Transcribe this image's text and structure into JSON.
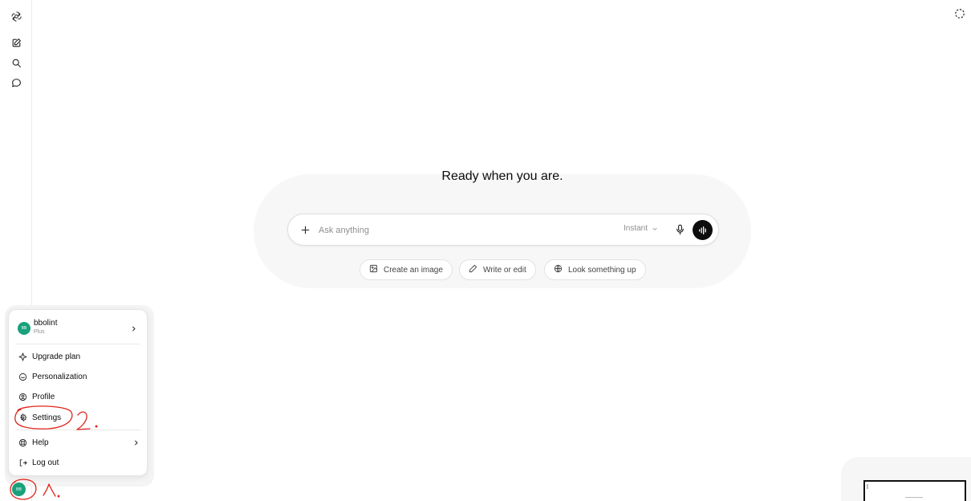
{
  "sidebar": {
    "logo_icon": "openai-logo-icon",
    "items": [
      {
        "name": "new-chat",
        "icon": "edit-icon"
      },
      {
        "name": "search",
        "icon": "search-icon"
      },
      {
        "name": "chats",
        "icon": "chat-bubble-icon"
      }
    ]
  },
  "main": {
    "headline": "Ready when you are.",
    "composer": {
      "placeholder": "Ask anything",
      "model": "Instant"
    },
    "chips": [
      {
        "label": "Create an image",
        "icon": "image-icon"
      },
      {
        "label": "Write or edit",
        "icon": "pen-icon"
      },
      {
        "label": "Look something up",
        "icon": "globe-icon"
      }
    ]
  },
  "account_menu": {
    "user": {
      "initials": "BB",
      "name": "bbolint",
      "plan": "Plus"
    },
    "items": [
      {
        "label": "Upgrade plan",
        "icon": "sparkle-icon"
      },
      {
        "label": "Personalization",
        "icon": "personalization-icon"
      },
      {
        "label": "Profile",
        "icon": "profile-icon"
      },
      {
        "label": "Settings",
        "icon": "gear-icon"
      },
      {
        "label": "Help",
        "icon": "lifebuoy-icon"
      },
      {
        "label": "Log out",
        "icon": "logout-icon"
      }
    ]
  },
  "avatar_initials": "BB",
  "colors": {
    "avatar": "#19a17c",
    "annotation": "#e0241b",
    "voice_button": "#0d0d0d"
  }
}
